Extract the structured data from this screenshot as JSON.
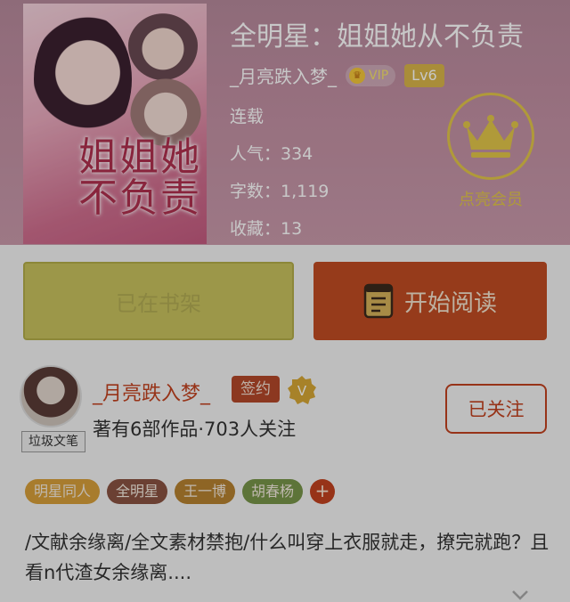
{
  "book": {
    "title": "全明星：姐姐她从不负责",
    "author": "_月亮跌入梦_",
    "vip_label": "VIP",
    "level": "Lv6",
    "status": "连载",
    "popularity": "人气：334",
    "word_count": "字数：1,119",
    "favorites": "收藏：13",
    "cover_title": "姐姐她不负责"
  },
  "member": {
    "label": "点亮会员"
  },
  "actions": {
    "shelf_label": "已在书架",
    "read_label": "开始阅读"
  },
  "author_card": {
    "name": "_月亮跌入梦_",
    "sign_label": "签约",
    "verify_glyph": "V",
    "stats": "著有6部作品·703人关注",
    "avatar_tag": "垃圾文笔",
    "follow_label": "已关注"
  },
  "tags": [
    "明星同人",
    "全明星",
    "王一博",
    "胡春杨"
  ],
  "tag_add": "+",
  "synopsis": "/文献余缘离/全文素材禁抱/什么叫穿上衣服就走，撩完就跑？且看n代渣女余缘离....",
  "colors": {
    "accent": "#c2421f",
    "gold": "#e2c64a",
    "shelf": "#c8c25e",
    "read": "#c04c23"
  }
}
